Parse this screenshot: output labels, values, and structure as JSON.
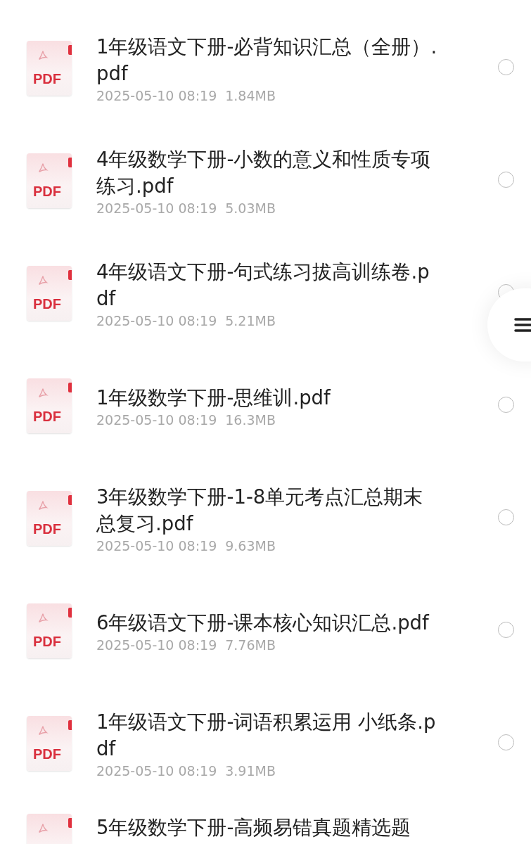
{
  "files": [
    {
      "icon_label": "PDF",
      "name": "1年级语文下册-必背知识汇总（全册）.pdf",
      "date": "2025-05-10 08:19",
      "size": "1.84MB",
      "selected": false
    },
    {
      "icon_label": "PDF",
      "name": "4年级数学下册-小数的意义和性质专项练习.pdf",
      "date": "2025-05-10 08:19",
      "size": "5.03MB",
      "selected": false
    },
    {
      "icon_label": "PDF",
      "name": "4年级语文下册-句式练习拔高训练卷.pdf",
      "date": "2025-05-10 08:19",
      "size": "5.21MB",
      "selected": false
    },
    {
      "icon_label": "PDF",
      "name": "1年级数学下册-思维训.pdf",
      "date": "2025-05-10 08:19",
      "size": "16.3MB",
      "selected": false
    },
    {
      "icon_label": "PDF",
      "name": "3年级数学下册-1-8单元考点汇总期末总复习.pdf",
      "date": "2025-05-10 08:19",
      "size": "9.63MB",
      "selected": false
    },
    {
      "icon_label": "PDF",
      "name": "6年级语文下册-课本核心知识汇总.pdf",
      "date": "2025-05-10 08:19",
      "size": "7.76MB",
      "selected": false
    },
    {
      "icon_label": "PDF",
      "name": "1年级语文下册-词语积累运用 小纸条.pdf",
      "date": "2025-05-10 08:19",
      "size": "3.91MB",
      "selected": false
    },
    {
      "name": "5年级数学下册-高频易错真题精选题"
    }
  ]
}
